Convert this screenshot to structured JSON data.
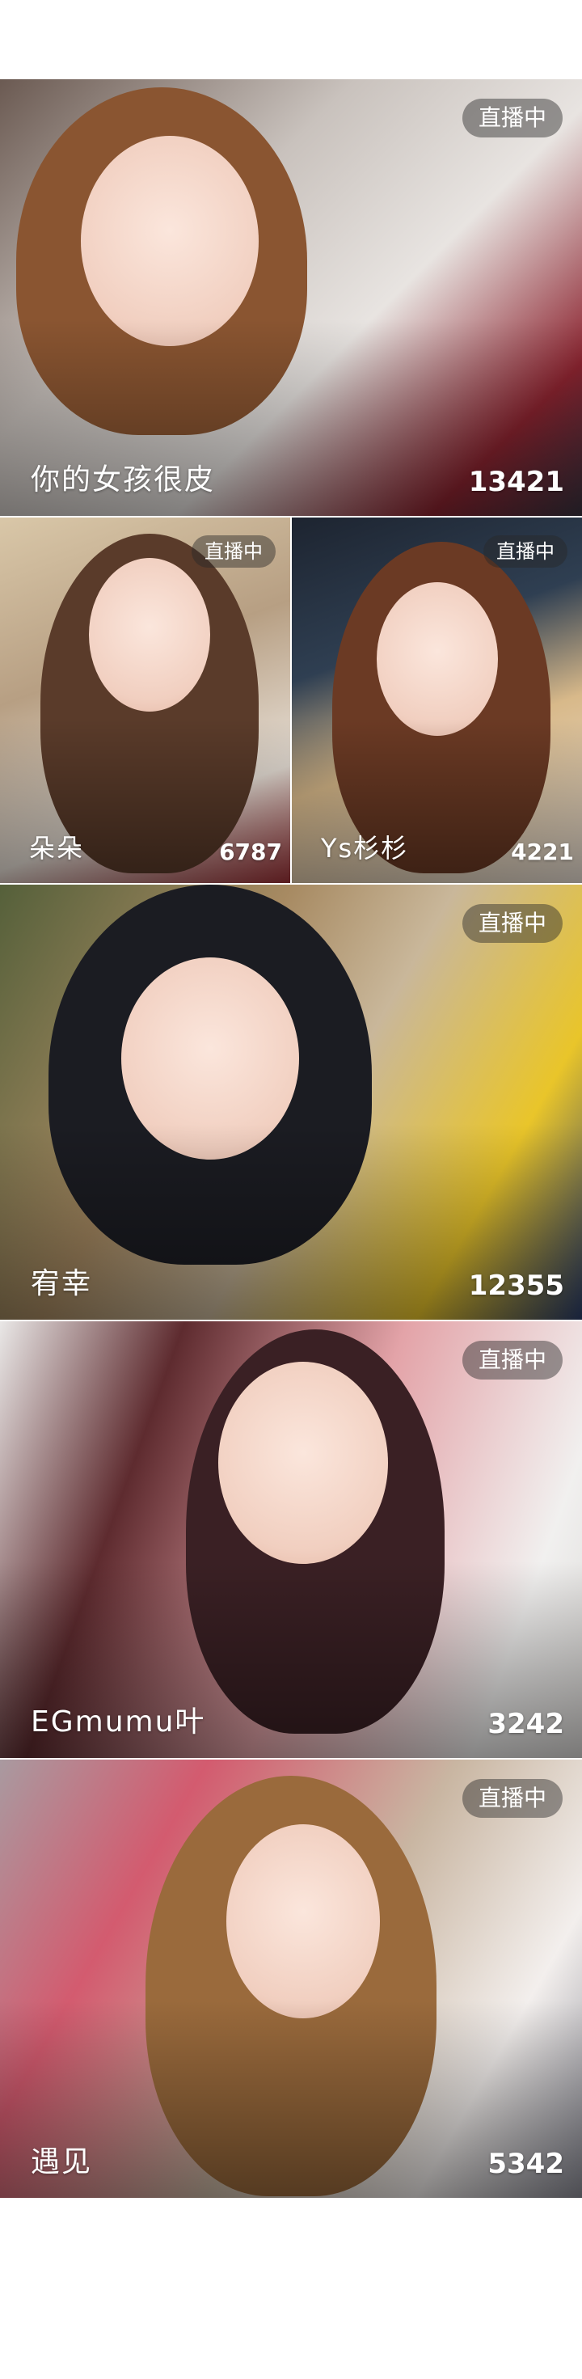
{
  "live_badge_label": "直播中",
  "streams": [
    {
      "name": "你的女孩很皮",
      "viewers": "13421"
    },
    {
      "name": "朵朵",
      "viewers": "6787"
    },
    {
      "name": "Ys杉杉",
      "viewers": "4221"
    },
    {
      "name": "宥幸",
      "viewers": "12355"
    },
    {
      "name": "EGmumu叶",
      "viewers": "3242"
    },
    {
      "name": "遇见",
      "viewers": "5342"
    }
  ]
}
